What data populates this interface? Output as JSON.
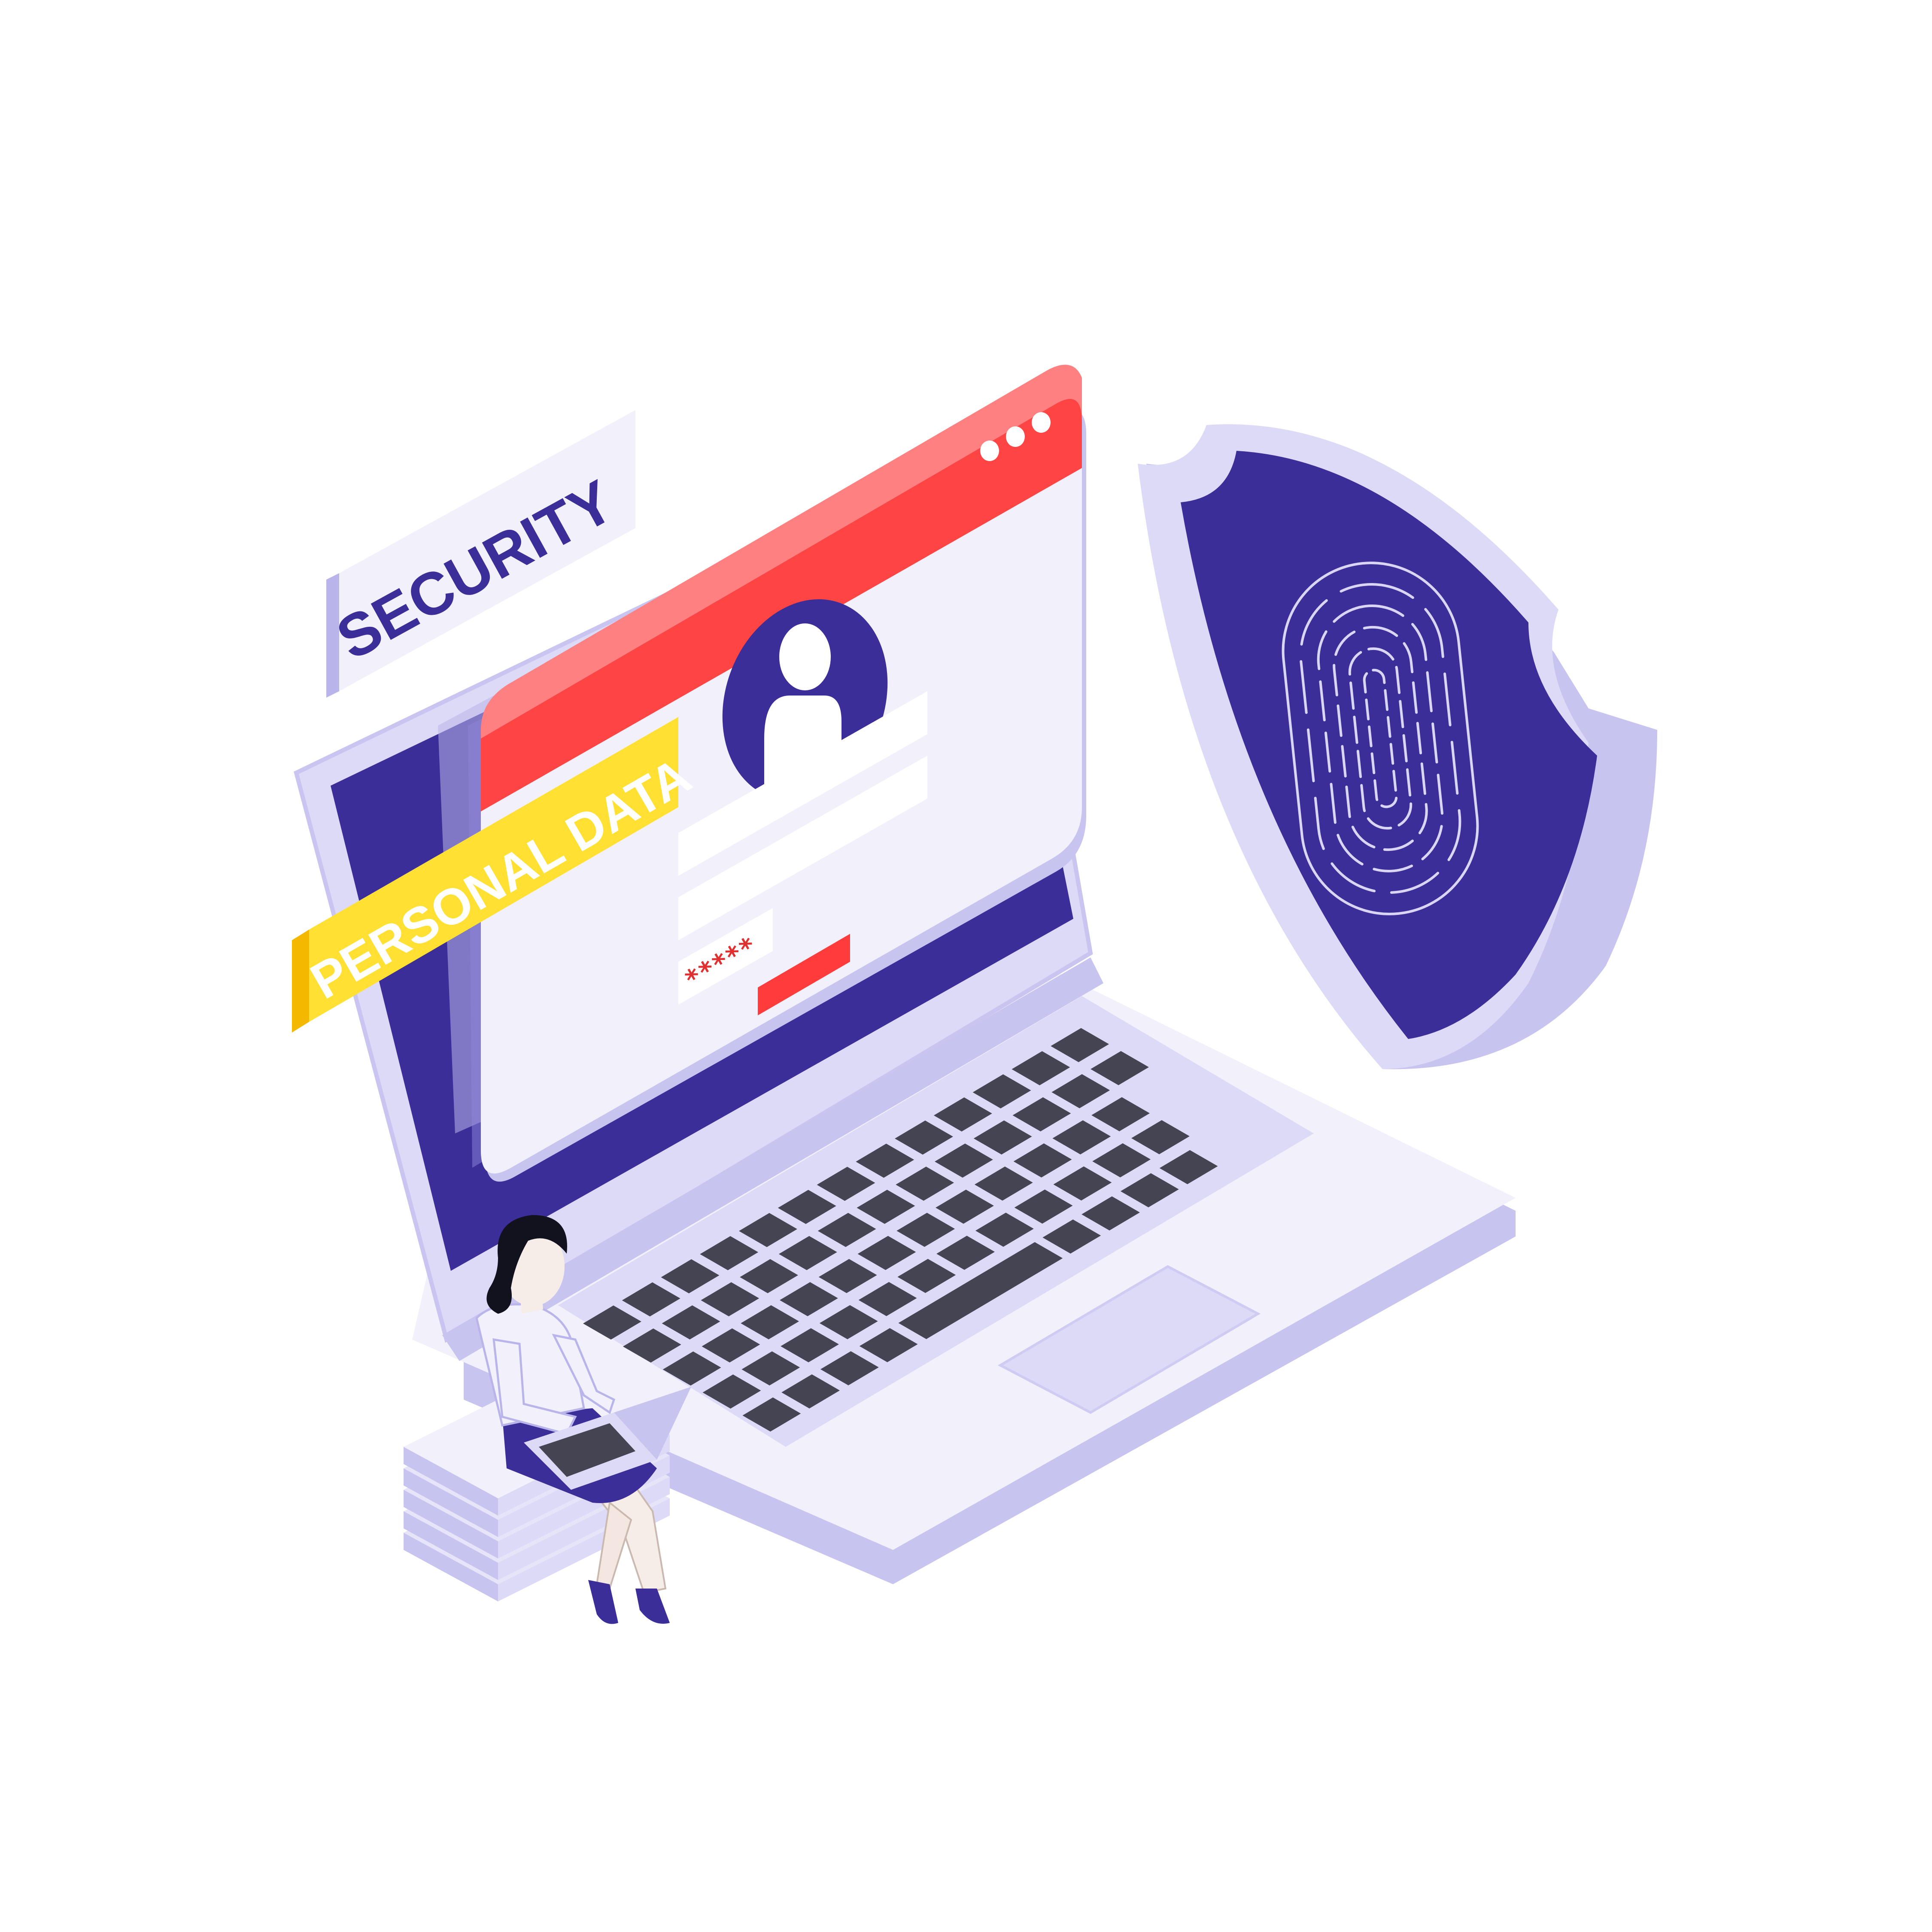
{
  "labels": {
    "security": "SECURITY",
    "personal_data": "PERSONAL DATA",
    "password_mask": "*****"
  },
  "window": {
    "menu_dots": "•••"
  },
  "colors": {
    "background": "#ffffff",
    "brand_navy": "#3b2e99",
    "alert_red": "#ff4444",
    "badge_yellow": "#ffe033",
    "badge_yellow_side": "#f5b800",
    "lavender": "#dcdaf6",
    "lavender_dark": "#b9b5ea",
    "panel": "#f2f1fb",
    "key": "#444452"
  },
  "icons": {
    "user": "user-avatar-icon",
    "fingerprint": "fingerprint-icon",
    "shield": "shield-icon",
    "laptop": "laptop-icon"
  }
}
